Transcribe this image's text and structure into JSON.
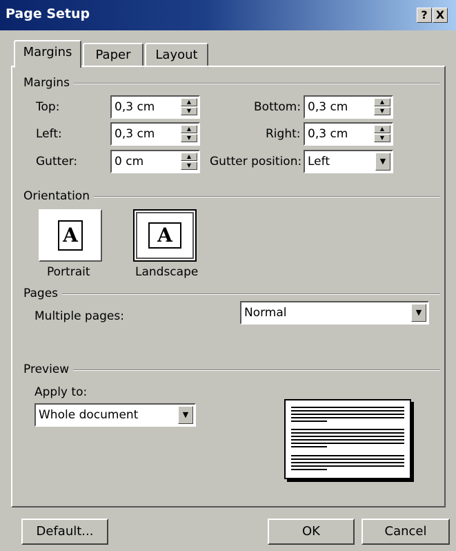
{
  "window": {
    "title": "Page Setup",
    "help_label": "?",
    "close_label": "X"
  },
  "tabs": [
    {
      "label": "Margins"
    },
    {
      "label": "Paper"
    },
    {
      "label": "Layout"
    }
  ],
  "margins": {
    "group_title": "Margins",
    "top": {
      "label": "Top:",
      "value": "0,3 cm"
    },
    "left": {
      "label": "Left:",
      "value": "0,3 cm"
    },
    "gutter": {
      "label": "Gutter:",
      "value": "0 cm"
    },
    "bottom": {
      "label": "Bottom:",
      "value": "0,3 cm"
    },
    "right": {
      "label": "Right:",
      "value": "0,3 cm"
    },
    "gutter_position": {
      "label": "Gutter position:",
      "value": "Left"
    }
  },
  "orientation": {
    "group_title": "Orientation",
    "portrait_label": "Portrait",
    "landscape_label": "Landscape",
    "icon_letter": "A",
    "selected": "Landscape"
  },
  "pages": {
    "group_title": "Pages",
    "multiple_pages_label": "Multiple pages:",
    "multiple_pages_value": "Normal"
  },
  "preview": {
    "group_title": "Preview",
    "apply_to_label": "Apply to:",
    "apply_to_value": "Whole document"
  },
  "footer": {
    "default_label": "Default...",
    "ok_label": "OK",
    "cancel_label": "Cancel"
  }
}
